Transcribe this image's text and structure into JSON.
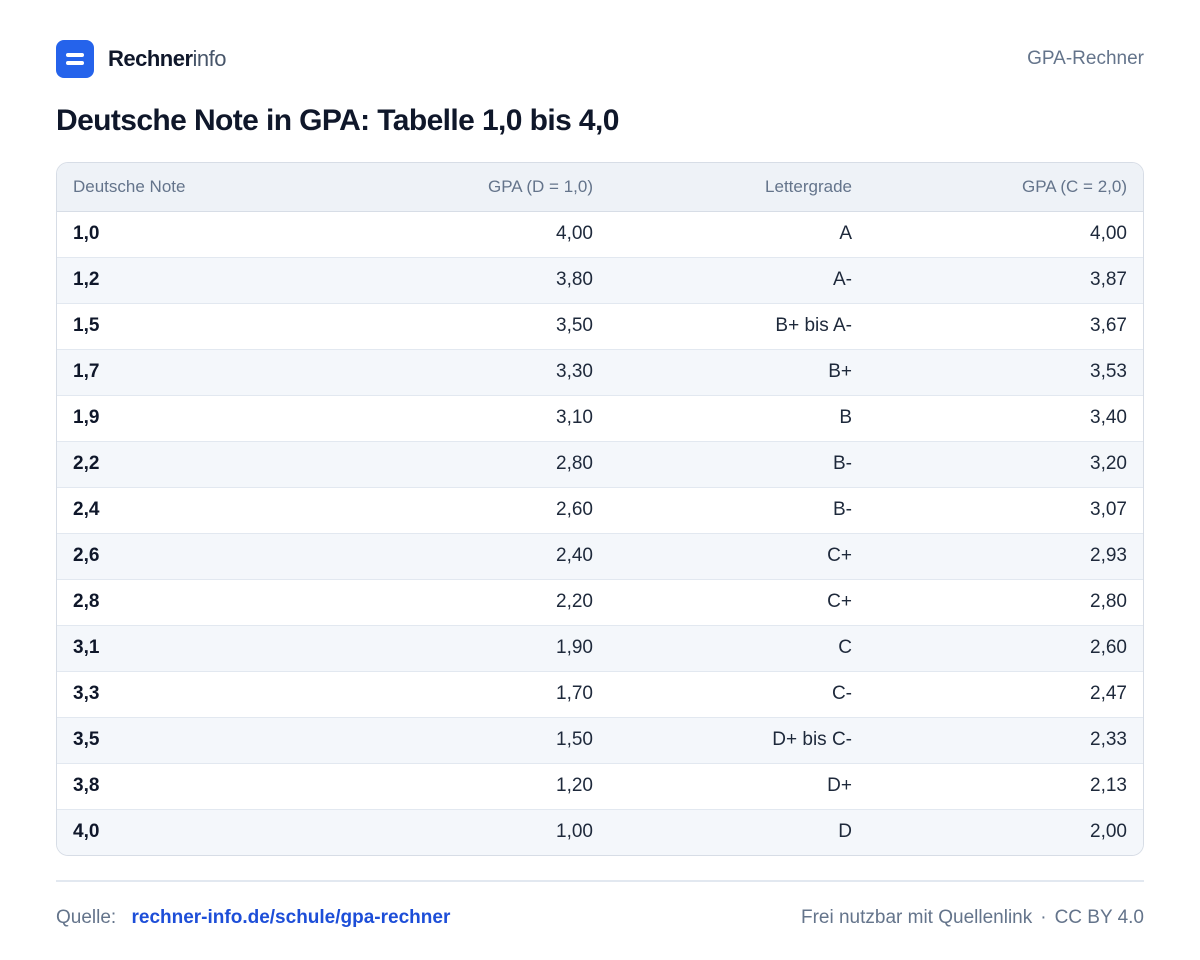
{
  "header": {
    "brand_bold": "Rechner",
    "brand_light": "info",
    "right_label": "GPA-Rechner"
  },
  "title": "Deutsche Note in GPA: Tabelle 1,0 bis 4,0",
  "table": {
    "columns": [
      "Deutsche Note",
      "GPA (D = 1,0)",
      "Lettergrade",
      "GPA (C = 2,0)"
    ],
    "rows": [
      [
        "1,0",
        "4,00",
        "A",
        "4,00"
      ],
      [
        "1,2",
        "3,80",
        "A-",
        "3,87"
      ],
      [
        "1,5",
        "3,50",
        "B+ bis A-",
        "3,67"
      ],
      [
        "1,7",
        "3,30",
        "B+",
        "3,53"
      ],
      [
        "1,9",
        "3,10",
        "B",
        "3,40"
      ],
      [
        "2,2",
        "2,80",
        "B-",
        "3,20"
      ],
      [
        "2,4",
        "2,60",
        "B-",
        "3,07"
      ],
      [
        "2,6",
        "2,40",
        "C+",
        "2,93"
      ],
      [
        "2,8",
        "2,20",
        "C+",
        "2,80"
      ],
      [
        "3,1",
        "1,90",
        "C",
        "2,60"
      ],
      [
        "3,3",
        "1,70",
        "C-",
        "2,47"
      ],
      [
        "3,5",
        "1,50",
        "D+ bis C-",
        "2,33"
      ],
      [
        "3,8",
        "1,20",
        "D+",
        "2,13"
      ],
      [
        "4,0",
        "1,00",
        "D",
        "2,00"
      ]
    ]
  },
  "footer": {
    "source_label": "Quelle:",
    "source_link": "rechner-info.de/schule/gpa-rechner",
    "license_text": "Frei nutzbar mit Quellenlink",
    "separator": "·",
    "license": "CC BY 4.0"
  },
  "colors": {
    "accent": "#2563eb",
    "link": "#1d4ed8",
    "header_bg": "#eef2f7",
    "stripe_bg": "#f4f7fb"
  },
  "icons": {
    "logo": "document-lines-icon"
  }
}
